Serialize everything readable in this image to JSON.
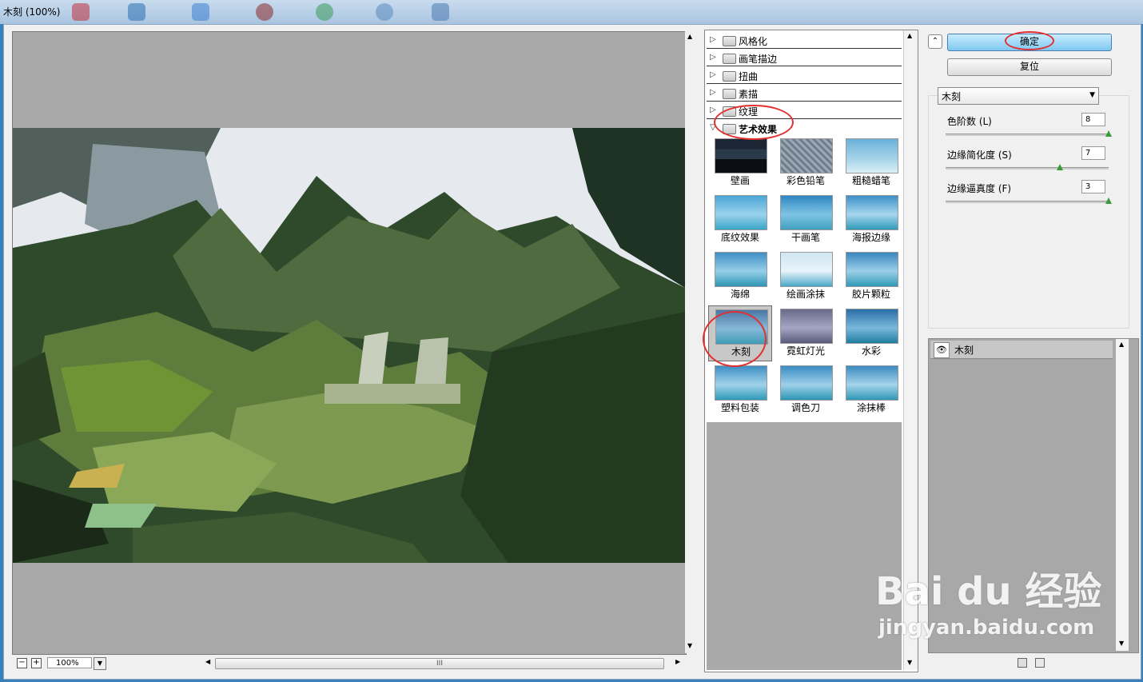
{
  "window": {
    "title": "木刻 (100%)"
  },
  "preview": {
    "zoom": "100%",
    "scroll_grip": "III"
  },
  "gallery": {
    "categories": [
      {
        "label": "风格化"
      },
      {
        "label": "画笔描边"
      },
      {
        "label": "扭曲"
      },
      {
        "label": "素描"
      },
      {
        "label": "纹理"
      },
      {
        "label": "艺术效果"
      }
    ],
    "thumbnails": [
      "壁画",
      "彩色铅笔",
      "粗糙蜡笔",
      "底纹效果",
      "干画笔",
      "海报边缘",
      "海绵",
      "绘画涂抹",
      "胶片颗粒",
      "木刻",
      "霓虹灯光",
      "水彩",
      "塑料包装",
      "调色刀",
      "涂抹棒"
    ],
    "selected": "木刻"
  },
  "buttons": {
    "ok": "确定",
    "reset": "复位"
  },
  "filter_select": {
    "value": "木刻"
  },
  "params": [
    {
      "label": "色阶数 (L)",
      "value": "8",
      "fraction": 1.0
    },
    {
      "label": "边缘简化度 (S)",
      "value": "7",
      "fraction": 0.7
    },
    {
      "label": "边缘逼真度 (F)",
      "value": "3",
      "fraction": 1.0
    }
  ],
  "layers": [
    {
      "name": "木刻"
    }
  ],
  "watermark": {
    "brand": "Bai du 经验",
    "url": "jingyan.baidu.com"
  },
  "colors": {
    "ok_button": "#7fc8f0",
    "highlight_ring": "#e03030",
    "canvas_gray": "#a8a8a8"
  }
}
